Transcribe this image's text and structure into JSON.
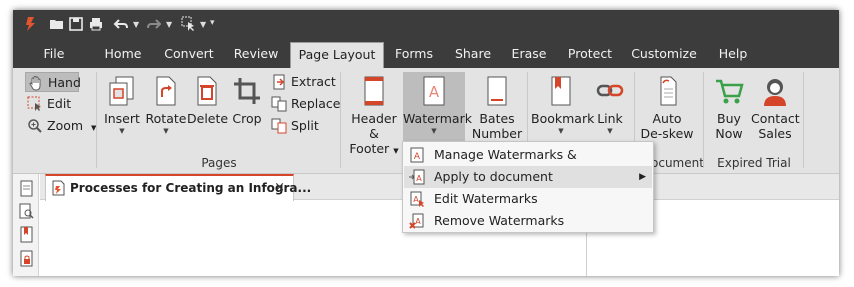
{
  "tabs": [
    {
      "label": "File"
    },
    {
      "label": "Home"
    },
    {
      "label": "Convert"
    },
    {
      "label": "Review"
    },
    {
      "label": "Page Layout"
    },
    {
      "label": "Forms"
    },
    {
      "label": "Share"
    },
    {
      "label": "Erase"
    },
    {
      "label": "Protect"
    },
    {
      "label": "Customize"
    },
    {
      "label": "Help"
    }
  ],
  "ribbon": {
    "tools": {
      "hand": "Hand",
      "edit": "Edit",
      "zoom": "Zoom"
    },
    "pages": {
      "insert": "Insert",
      "rotate": "Rotate",
      "delete": "Delete",
      "crop": "Crop",
      "extract": "Extract",
      "replace": "Replace",
      "split": "Split",
      "group_label": "Pages"
    },
    "header_footer": {
      "line1": "Header &",
      "line2": "Footer"
    },
    "watermark": "Watermark",
    "bates": {
      "line1": "Bates",
      "line2": "Number"
    },
    "bookmark": "Bookmark",
    "link": "Link",
    "deskew": {
      "line1": "Auto",
      "line2": "De-skew",
      "group_label_partial": "ocument"
    },
    "trial": {
      "buy_line1": "Buy",
      "buy_line2": "Now",
      "contact_line1": "Contact",
      "contact_line2": "Sales",
      "group_label": "Expired Trial"
    }
  },
  "document_tab": {
    "title": "Processes for Creating an Infogra...",
    "close": "×"
  },
  "watermark_menu": [
    {
      "label": "Manage Watermarks & Backgrounds"
    },
    {
      "label": "Apply to document",
      "has_submenu": true
    },
    {
      "label": "Edit Watermarks"
    },
    {
      "label": "Remove Watermarks"
    }
  ],
  "colors": {
    "accent": "#d4452a",
    "dark_bar": "#3c3c3c",
    "ribbon": "#e3e3e3",
    "cart_green": "#3aa04a"
  }
}
